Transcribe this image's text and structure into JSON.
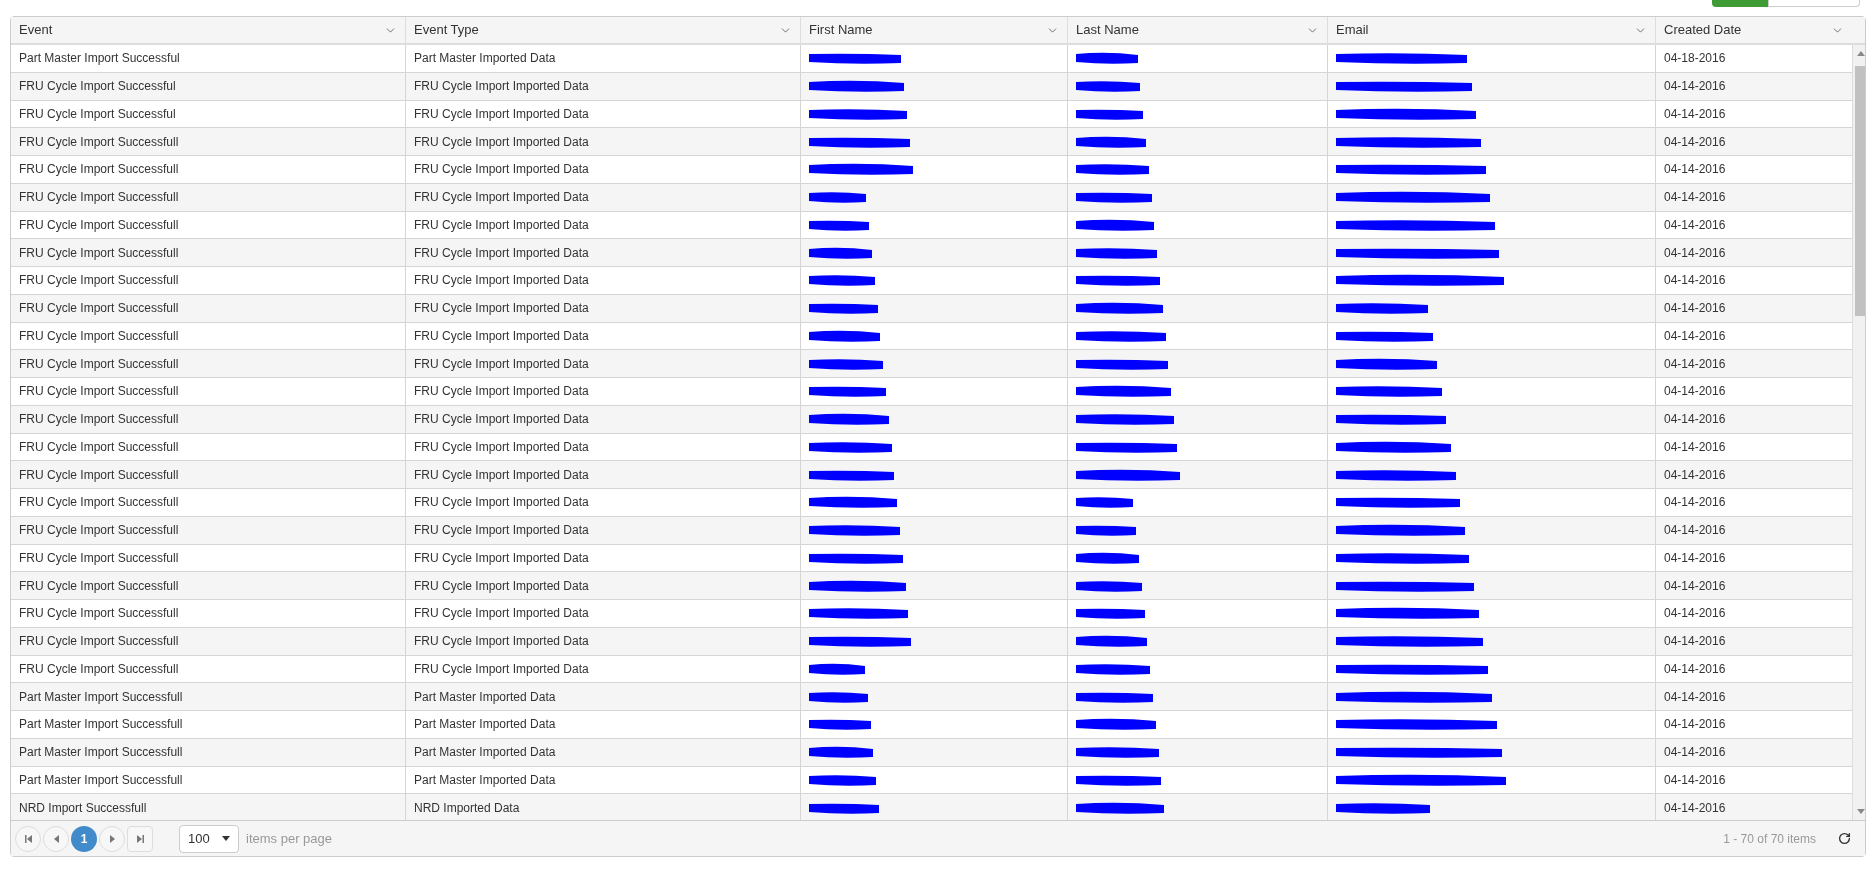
{
  "table": {
    "columns": [
      {
        "label": "Event"
      },
      {
        "label": "Event Type"
      },
      {
        "label": "First Name"
      },
      {
        "label": "Last Name"
      },
      {
        "label": "Email"
      },
      {
        "label": "Created Date"
      }
    ],
    "rows": [
      {
        "event": "Part Master Import Successful",
        "event_type": "Part Master Imported Data",
        "redacted": true,
        "created_date": "04-18-2016"
      },
      {
        "event": "FRU Cycle Import Successful",
        "event_type": "FRU Cycle Import Imported Data",
        "redacted": true,
        "created_date": "04-14-2016"
      },
      {
        "event": "FRU Cycle Import Successful",
        "event_type": "FRU Cycle Import Imported Data",
        "redacted": true,
        "created_date": "04-14-2016"
      },
      {
        "event": "FRU Cycle Import Successfull",
        "event_type": "FRU Cycle Import Imported Data",
        "redacted": true,
        "created_date": "04-14-2016"
      },
      {
        "event": "FRU Cycle Import Successfull",
        "event_type": "FRU Cycle Import Imported Data",
        "redacted": true,
        "created_date": "04-14-2016"
      },
      {
        "event": "FRU Cycle Import Successfull",
        "event_type": "FRU Cycle Import Imported Data",
        "redacted": true,
        "created_date": "04-14-2016"
      },
      {
        "event": "FRU Cycle Import Successfull",
        "event_type": "FRU Cycle Import Imported Data",
        "redacted": true,
        "created_date": "04-14-2016"
      },
      {
        "event": "FRU Cycle Import Successfull",
        "event_type": "FRU Cycle Import Imported Data",
        "redacted": true,
        "created_date": "04-14-2016"
      },
      {
        "event": "FRU Cycle Import Successfull",
        "event_type": "FRU Cycle Import Imported Data",
        "redacted": true,
        "created_date": "04-14-2016"
      },
      {
        "event": "FRU Cycle Import Successfull",
        "event_type": "FRU Cycle Import Imported Data",
        "redacted": true,
        "created_date": "04-14-2016"
      },
      {
        "event": "FRU Cycle Import Successfull",
        "event_type": "FRU Cycle Import Imported Data",
        "redacted": true,
        "created_date": "04-14-2016"
      },
      {
        "event": "FRU Cycle Import Successfull",
        "event_type": "FRU Cycle Import Imported Data",
        "redacted": true,
        "created_date": "04-14-2016"
      },
      {
        "event": "FRU Cycle Import Successfull",
        "event_type": "FRU Cycle Import Imported Data",
        "redacted": true,
        "created_date": "04-14-2016"
      },
      {
        "event": "FRU Cycle Import Successfull",
        "event_type": "FRU Cycle Import Imported Data",
        "redacted": true,
        "created_date": "04-14-2016"
      },
      {
        "event": "FRU Cycle Import Successfull",
        "event_type": "FRU Cycle Import Imported Data",
        "redacted": true,
        "created_date": "04-14-2016"
      },
      {
        "event": "FRU Cycle Import Successfull",
        "event_type": "FRU Cycle Import Imported Data",
        "redacted": true,
        "created_date": "04-14-2016"
      },
      {
        "event": "FRU Cycle Import Successfull",
        "event_type": "FRU Cycle Import Imported Data",
        "redacted": true,
        "created_date": "04-14-2016"
      },
      {
        "event": "FRU Cycle Import Successfull",
        "event_type": "FRU Cycle Import Imported Data",
        "redacted": true,
        "created_date": "04-14-2016"
      },
      {
        "event": "FRU Cycle Import Successfull",
        "event_type": "FRU Cycle Import Imported Data",
        "redacted": true,
        "created_date": "04-14-2016"
      },
      {
        "event": "FRU Cycle Import Successfull",
        "event_type": "FRU Cycle Import Imported Data",
        "redacted": true,
        "created_date": "04-14-2016"
      },
      {
        "event": "FRU Cycle Import Successfull",
        "event_type": "FRU Cycle Import Imported Data",
        "redacted": true,
        "created_date": "04-14-2016"
      },
      {
        "event": "FRU Cycle Import Successfull",
        "event_type": "FRU Cycle Import Imported Data",
        "redacted": true,
        "created_date": "04-14-2016"
      },
      {
        "event": "FRU Cycle Import Successfull",
        "event_type": "FRU Cycle Import Imported Data",
        "redacted": true,
        "created_date": "04-14-2016"
      },
      {
        "event": "Part Master Import Successfull",
        "event_type": "Part Master Imported Data",
        "redacted": true,
        "created_date": "04-14-2016"
      },
      {
        "event": "Part Master Import Successfull",
        "event_type": "Part Master Imported Data",
        "redacted": true,
        "created_date": "04-14-2016"
      },
      {
        "event": "Part Master Import Successfull",
        "event_type": "Part Master Imported Data",
        "redacted": true,
        "created_date": "04-14-2016"
      },
      {
        "event": "Part Master Import Successfull",
        "event_type": "Part Master Imported Data",
        "redacted": true,
        "created_date": "04-14-2016"
      },
      {
        "event": "NRD Import Successfull",
        "event_type": "NRD Imported Data",
        "redacted": true,
        "created_date": "04-14-2016"
      }
    ]
  },
  "pager": {
    "pages": [
      {
        "label": "1",
        "selected": true
      }
    ],
    "page_size": "100",
    "page_size_label": "items per page",
    "summary": "1 - 70 of 70 items"
  }
}
